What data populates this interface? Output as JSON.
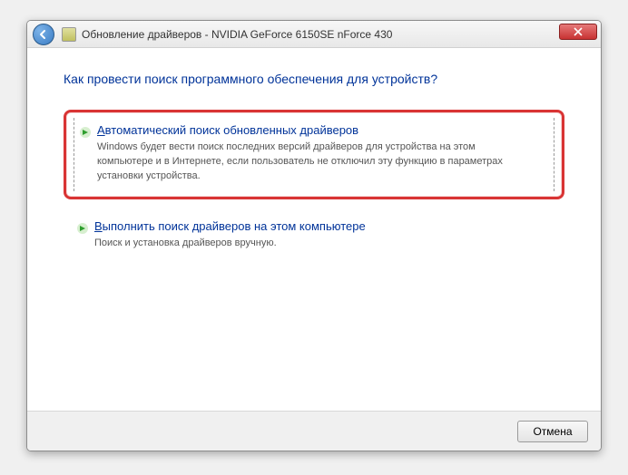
{
  "window": {
    "title": "Обновление драйверов - NVIDIA GeForce 6150SE nForce 430"
  },
  "heading": "Как провести поиск программного обеспечения для устройств?",
  "options": [
    {
      "title_prefix": "А",
      "title_rest": "втоматический поиск обновленных драйверов",
      "desc": "Windows будет вести поиск последних версий драйверов для устройства на этом компьютере и в Интернете, если пользователь не отключил эту функцию в параметрах установки устройства."
    },
    {
      "title_prefix": "В",
      "title_rest": "ыполнить поиск драйверов на этом компьютере",
      "desc": "Поиск и установка драйверов вручную."
    }
  ],
  "footer": {
    "cancel": "Отмена"
  }
}
